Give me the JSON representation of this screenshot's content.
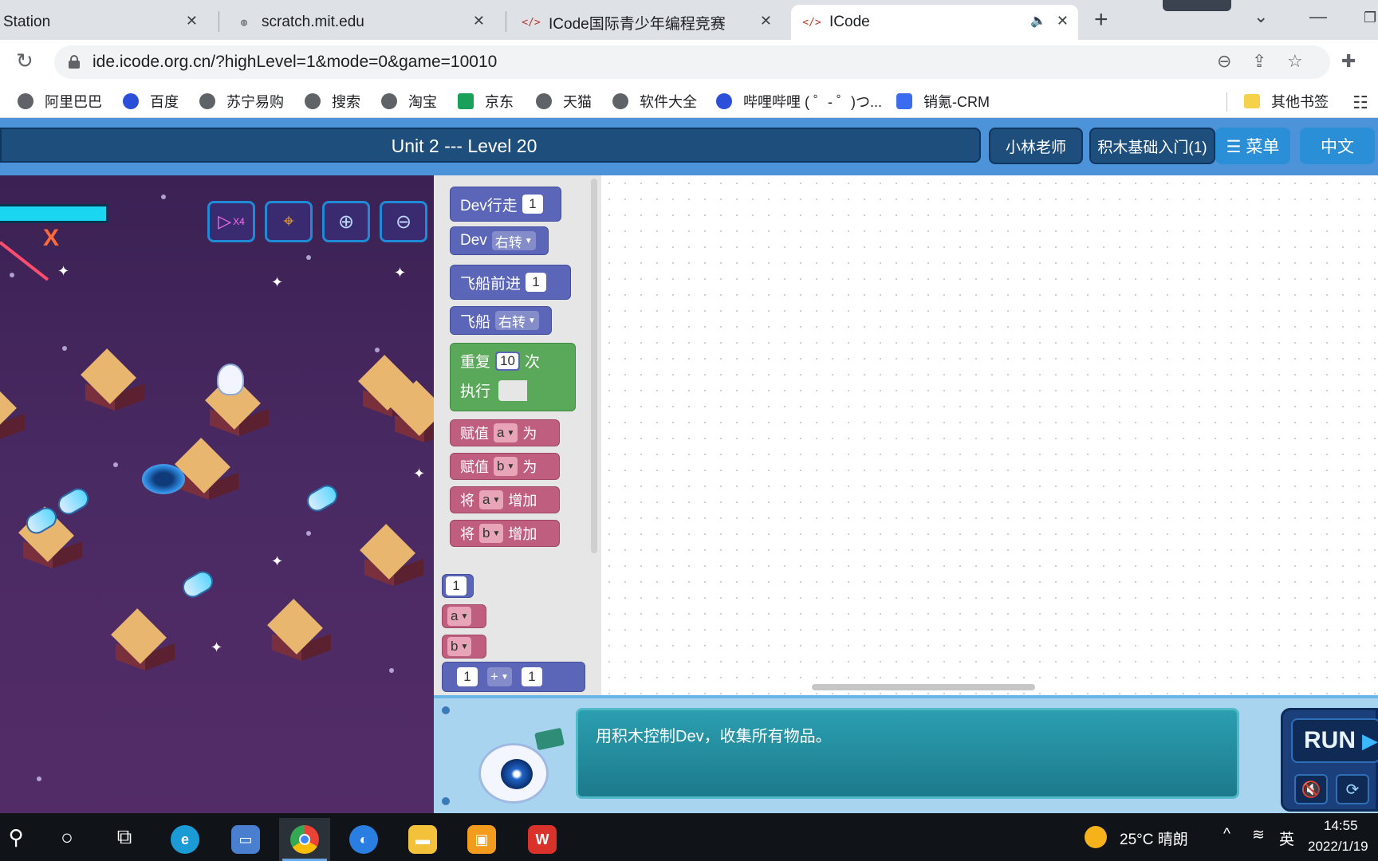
{
  "browser": {
    "tabs": [
      {
        "label": "Station"
      },
      {
        "label": "scratch.mit.edu"
      },
      {
        "label": "ICode国际青少年编程竞赛"
      },
      {
        "label": "ICode"
      }
    ],
    "url": "ide.icode.org.cn/?highLevel=1&mode=0&game=10010",
    "bookmarks": [
      {
        "label": "阿里巴巴"
      },
      {
        "label": "百度"
      },
      {
        "label": "苏宁易购"
      },
      {
        "label": "搜索"
      },
      {
        "label": "淘宝"
      },
      {
        "label": "京东"
      },
      {
        "label": "天猫"
      },
      {
        "label": "软件大全"
      },
      {
        "label": "哔哩哔哩 ( ゜- ゜)つ..."
      },
      {
        "label": "销氪-CRM"
      }
    ],
    "other_bookmarks": "其他书签"
  },
  "header": {
    "level_title": "Unit 2 --- Level 20",
    "teacher": "小林老师",
    "course": "积木基础入门(1)",
    "menu": "☰ 菜单",
    "language": "中文"
  },
  "game": {
    "speed_label": "X4"
  },
  "palette": {
    "dev_walk": "Dev行走",
    "dev_walk_value": "1",
    "dev_turn": "Dev",
    "dev_turn_dir": "右转",
    "ship_forward": "飞船前进",
    "ship_forward_value": "1",
    "ship_turn": "飞船",
    "ship_turn_dir": "右转",
    "repeat": "重复",
    "repeat_times": "10",
    "repeat_unit": "次",
    "repeat_do": "执行",
    "assign1_prefix": "赋值",
    "assign1_var": "a",
    "assign1_suffix": "为",
    "assign2_prefix": "赋值",
    "assign2_var": "b",
    "assign2_suffix": "为",
    "inc1_prefix": "将",
    "inc1_var": "a",
    "inc1_suffix": "增加",
    "inc2_prefix": "将",
    "inc2_var": "b",
    "inc2_suffix": "增加",
    "num_block": "1",
    "var_a": "a",
    "var_b": "b",
    "math_left": "1",
    "math_op": "+",
    "math_right": "1"
  },
  "instructions": {
    "message": "用积木控制Dev，收集所有物品。"
  },
  "controls": {
    "run": "RUN"
  },
  "taskbar": {
    "weather": "25°C  晴朗",
    "ime": "英",
    "time": "14:55",
    "date": "2022/1/19"
  }
}
